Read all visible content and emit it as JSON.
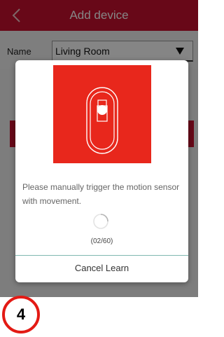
{
  "header": {
    "title": "Add device",
    "back_icon": "chevron-left-icon"
  },
  "form": {
    "name_label": "Name",
    "name_value": "Living Room",
    "dropdown_icon": "triangle-down-icon"
  },
  "dialog": {
    "image_icon": "motion-sensor-icon",
    "message": "Please manually trigger the motion sensor with movement.",
    "progress": "(02/60)",
    "cancel_label": "Cancel Learn"
  },
  "step_badge": "4",
  "colors": {
    "brand_red": "#c8102e",
    "image_red": "#e8271c",
    "divider_teal": "#7fb8b0",
    "badge_red": "#e31a14"
  }
}
